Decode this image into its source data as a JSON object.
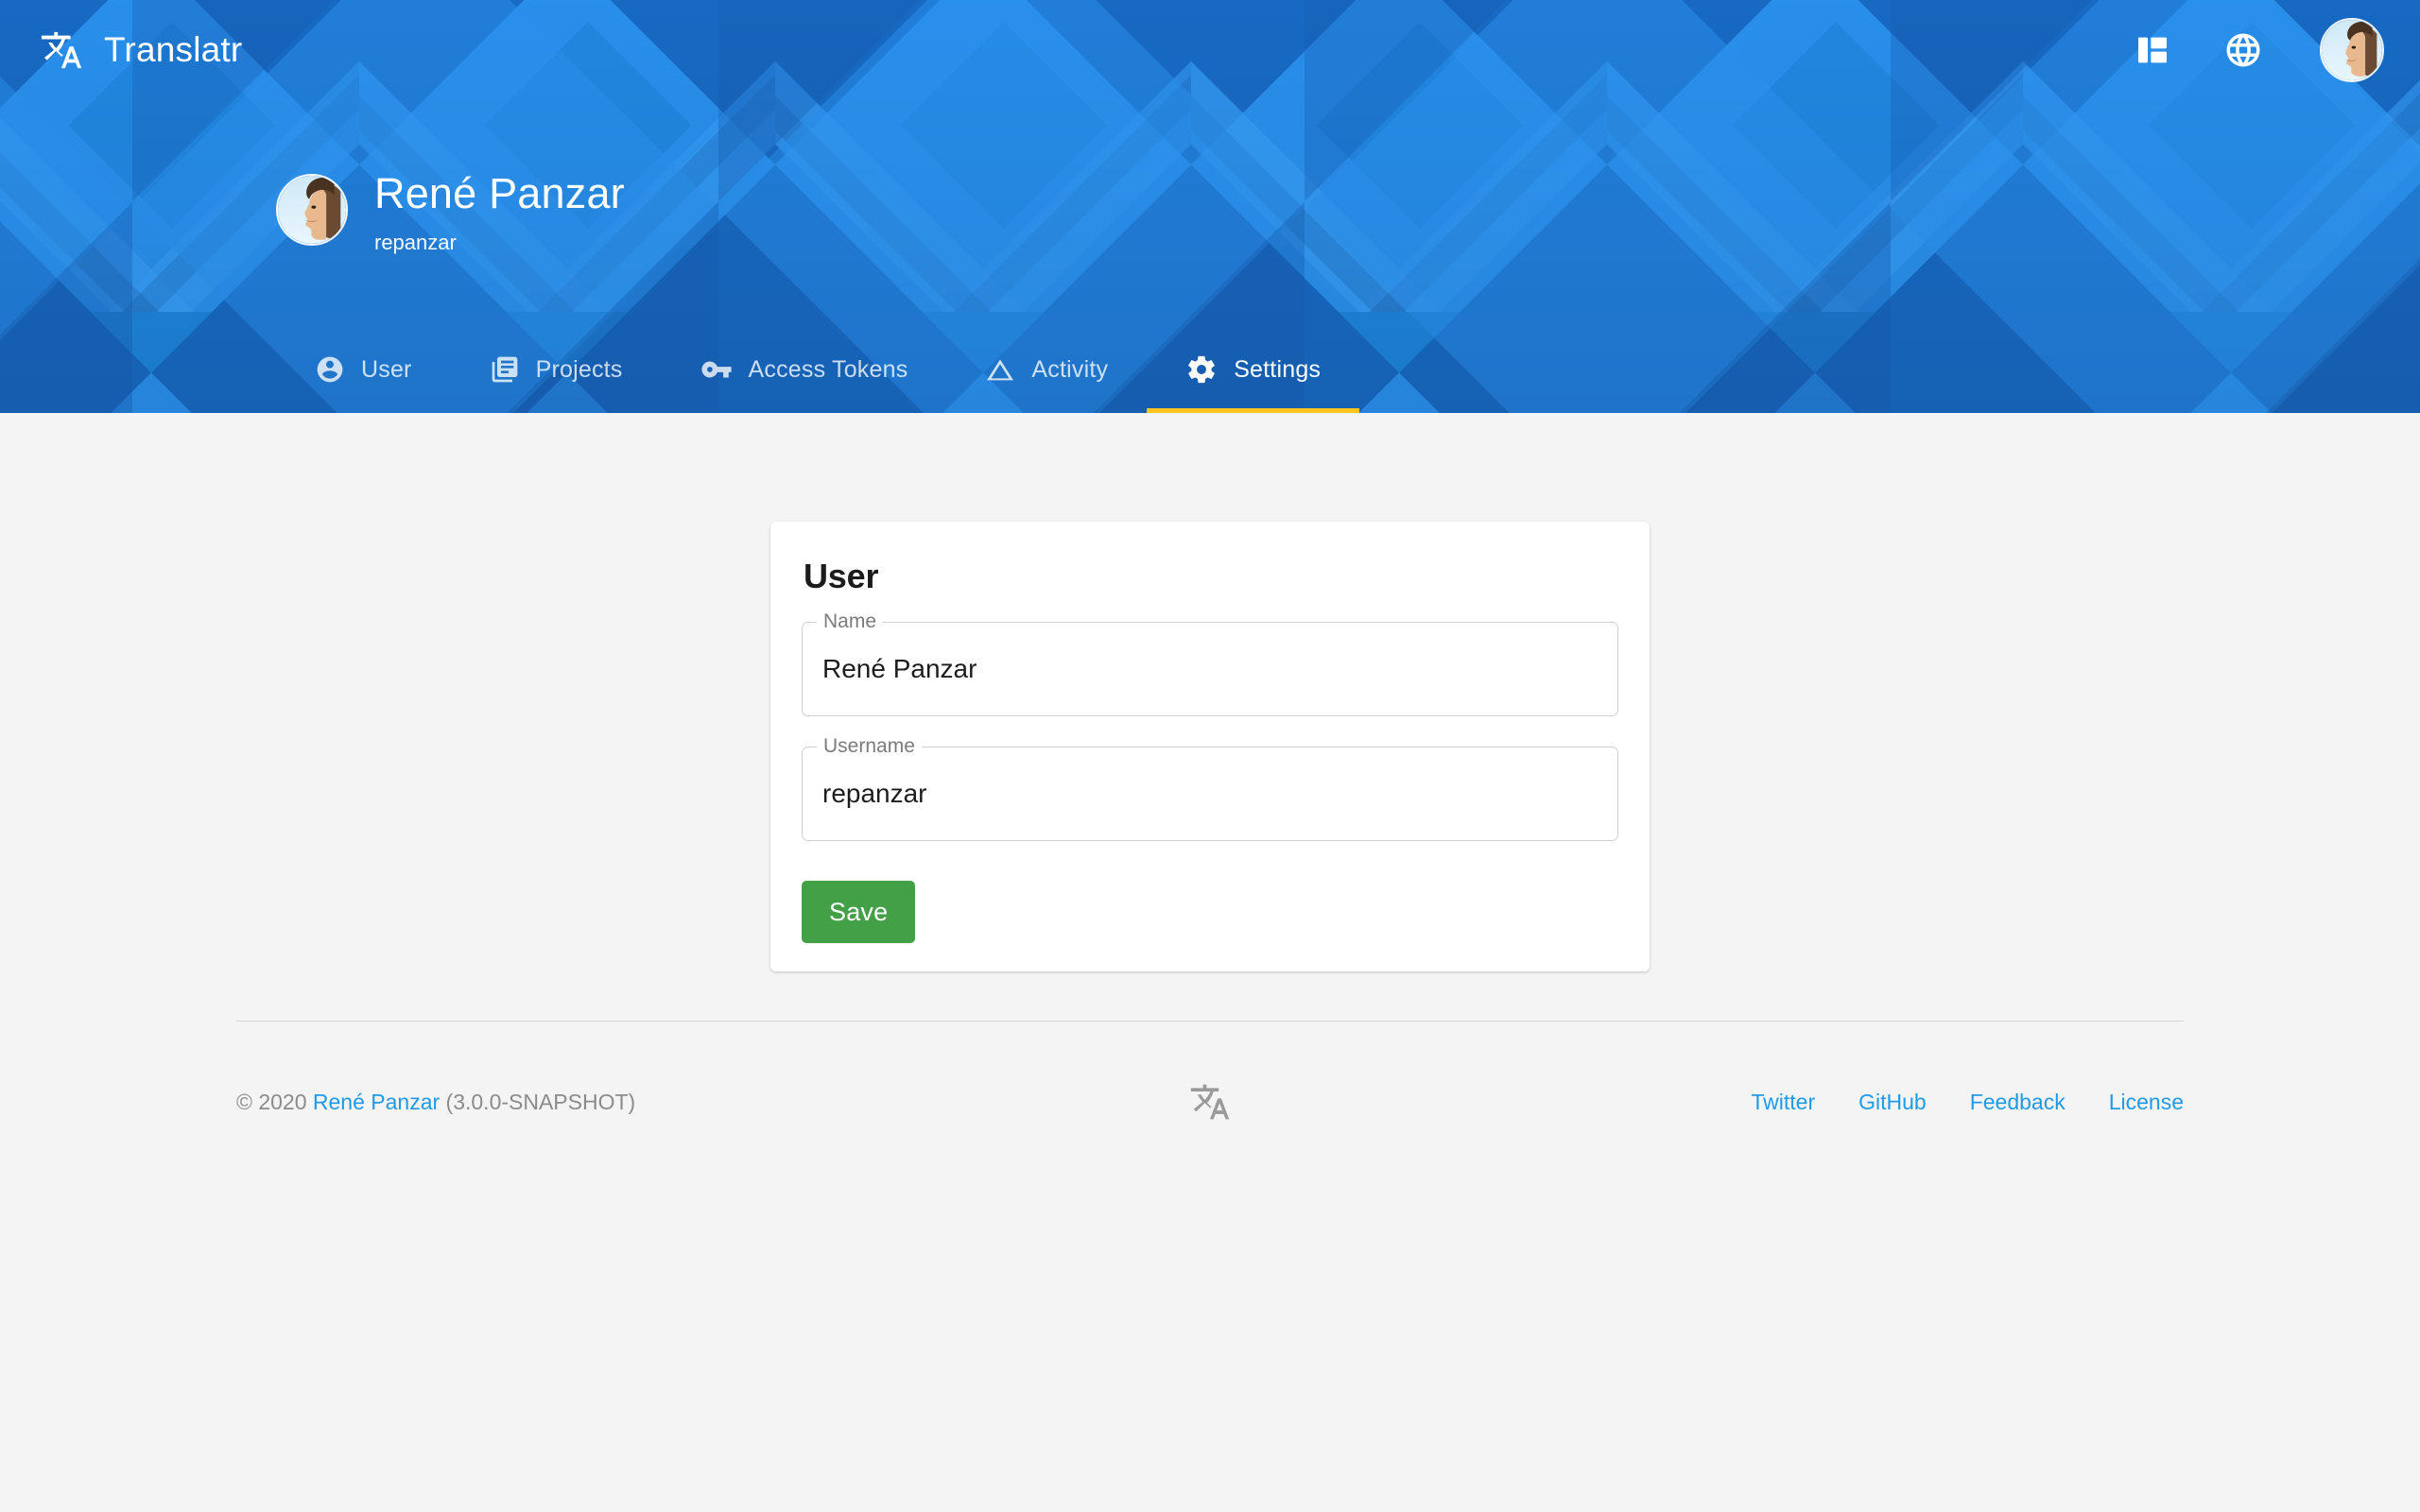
{
  "app": {
    "brand_name": "Translatr",
    "brand_icon": "translate-icon"
  },
  "topbar": {
    "dashboard_icon": "dashboard-layout-icon",
    "language_icon": "globe-icon",
    "avatar_icon": "user-avatar"
  },
  "profile": {
    "name": "René Panzar",
    "username": "repanzar"
  },
  "tabs": [
    {
      "label": "User",
      "icon": "account-circle-icon",
      "active": false
    },
    {
      "label": "Projects",
      "icon": "library-books-icon",
      "active": false
    },
    {
      "label": "Access Tokens",
      "icon": "vpn-key-icon",
      "active": false
    },
    {
      "label": "Activity",
      "icon": "triangle-icon",
      "active": false
    },
    {
      "label": "Settings",
      "icon": "gear-icon",
      "active": true
    }
  ],
  "card": {
    "title": "User",
    "fields": [
      {
        "legend": "Name",
        "value": "René Panzar",
        "placeholder": "Name"
      },
      {
        "legend": "Username",
        "value": "repanzar",
        "placeholder": "Username"
      }
    ],
    "save_label": "Save"
  },
  "footer": {
    "copyright_prefix": "© 2020 ",
    "author_link": "René Panzar",
    "version": " (3.0.0-SNAPSHOT)",
    "logo_icon": "translate-icon",
    "links": [
      {
        "label": "Twitter"
      },
      {
        "label": "GitHub"
      },
      {
        "label": "Feedback"
      },
      {
        "label": "License"
      }
    ]
  },
  "colors": {
    "brand_blue": "#1f87e0",
    "pattern_light": "#2196f3",
    "pattern_dark": "#1565c0",
    "accent_underline": "#ffc31f",
    "save_green": "#43a047",
    "link_blue": "#1e9ae6",
    "page_background": "#f4f4f4"
  }
}
